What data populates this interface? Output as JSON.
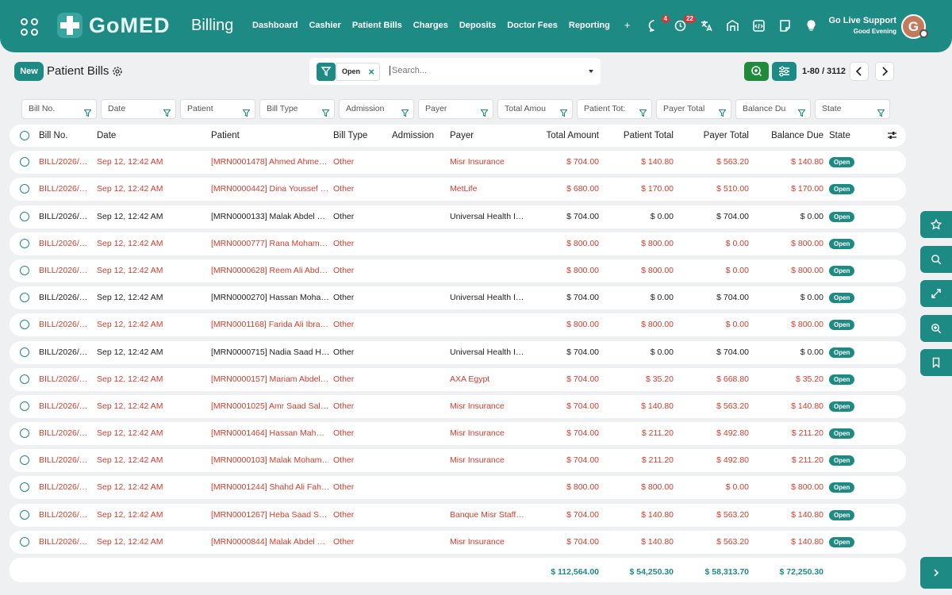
{
  "header": {
    "brand": "GoMED",
    "app_title": "Billing",
    "nav": [
      "Dashboard",
      "Cashier",
      "Patient Bills",
      "Charges",
      "Deposits",
      "Doctor Fees",
      "Reporting"
    ],
    "nav_plus": "+",
    "messages_count": "4",
    "activity_count": "22",
    "support_title": "Go Live Support",
    "support_greeting": "Good Evening",
    "avatar_initial": "G",
    "icons": [
      "apps-grid-icon",
      "chat-icon",
      "activity-icon",
      "translate-icon",
      "building-icon",
      "code-icon",
      "note-icon",
      "lightbulb-icon"
    ],
    "accent": "#1d8a84"
  },
  "toolbar": {
    "new_label": "New",
    "page_title": "Patient Bills",
    "facet_label": "Open",
    "facet_remove": "×",
    "search_placeholder": "Search...",
    "pager": "1-80 / 3112"
  },
  "filters": [
    "Bill No.",
    "Date",
    "Patient",
    "Bill Type",
    "Admission",
    "Payer",
    "Total Amou",
    "Patient Tot:",
    "Payer Total",
    "Balance Du",
    "State"
  ],
  "columns": [
    "Bill No.",
    "Date",
    "Patient",
    "Bill Type",
    "Admission",
    "Payer",
    "Total Amount",
    "Patient Total",
    "Payer Total",
    "Balance Due",
    "State"
  ],
  "rows": [
    {
      "bill": "BILL/2026/…",
      "date": "Sep 12, 12:42 AM",
      "patient": "[MRN0001478] Ahmed Ahme…",
      "type": "Other",
      "admission": "",
      "payer": "Misr Insurance",
      "total": "$ 704.00",
      "ptotal": "$ 140.80",
      "paytotal": "$ 563.20",
      "balance": "$ 140.80",
      "state": "Open",
      "style": "red"
    },
    {
      "bill": "BILL/2026/…",
      "date": "Sep 12, 12:42 AM",
      "patient": "[MRN0000442] Dina Youssef …",
      "type": "Other",
      "admission": "",
      "payer": "MetLife",
      "total": "$ 680.00",
      "ptotal": "$ 170.00",
      "paytotal": "$ 510.00",
      "balance": "$ 170.00",
      "state": "Open",
      "style": "red"
    },
    {
      "bill": "BILL/2026/…",
      "date": "Sep 12, 12:42 AM",
      "patient": "[MRN0000133] Malak Abdel …",
      "type": "Other",
      "admission": "",
      "payer": "Universal Health I…",
      "total": "$ 704.00",
      "ptotal": "$ 0.00",
      "paytotal": "$ 704.00",
      "balance": "$ 0.00",
      "state": "Open",
      "style": "dark"
    },
    {
      "bill": "BILL/2026/…",
      "date": "Sep 12, 12:42 AM",
      "patient": "[MRN0000777] Rana Moham…",
      "type": "Other",
      "admission": "",
      "payer": "",
      "total": "$ 800.00",
      "ptotal": "$ 800.00",
      "paytotal": "$ 0.00",
      "balance": "$ 800.00",
      "state": "Open",
      "style": "red"
    },
    {
      "bill": "BILL/2026/…",
      "date": "Sep 12, 12:42 AM",
      "patient": "[MRN0000628] Reem Ali Abd…",
      "type": "Other",
      "admission": "",
      "payer": "",
      "total": "$ 800.00",
      "ptotal": "$ 800.00",
      "paytotal": "$ 0.00",
      "balance": "$ 800.00",
      "state": "Open",
      "style": "red"
    },
    {
      "bill": "BILL/2026/…",
      "date": "Sep 12, 12:42 AM",
      "patient": "[MRN0000270] Hassan Moha…",
      "type": "Other",
      "admission": "",
      "payer": "Universal Health I…",
      "total": "$ 704.00",
      "ptotal": "$ 0.00",
      "paytotal": "$ 704.00",
      "balance": "$ 0.00",
      "state": "Open",
      "style": "dark"
    },
    {
      "bill": "BILL/2026/…",
      "date": "Sep 12, 12:42 AM",
      "patient": "[MRN0001168] Farida Ali Ibra…",
      "type": "Other",
      "admission": "",
      "payer": "",
      "total": "$ 800.00",
      "ptotal": "$ 800.00",
      "paytotal": "$ 0.00",
      "balance": "$ 800.00",
      "state": "Open",
      "style": "red"
    },
    {
      "bill": "BILL/2026/…",
      "date": "Sep 12, 12:42 AM",
      "patient": "[MRN0000715] Nadia Saad H…",
      "type": "Other",
      "admission": "",
      "payer": "Universal Health I…",
      "total": "$ 704.00",
      "ptotal": "$ 0.00",
      "paytotal": "$ 704.00",
      "balance": "$ 0.00",
      "state": "Open",
      "style": "dark"
    },
    {
      "bill": "BILL/2026/…",
      "date": "Sep 12, 12:42 AM",
      "patient": "[MRN0000157] Mariam Abdel…",
      "type": "Other",
      "admission": "",
      "payer": "AXA Egypt",
      "total": "$ 704.00",
      "ptotal": "$ 35.20",
      "paytotal": "$ 668.80",
      "balance": "$ 35.20",
      "state": "Open",
      "style": "red"
    },
    {
      "bill": "BILL/2026/…",
      "date": "Sep 12, 12:42 AM",
      "patient": "[MRN0001025] Amr Saad Sal…",
      "type": "Other",
      "admission": "",
      "payer": "Misr Insurance",
      "total": "$ 704.00",
      "ptotal": "$ 140.80",
      "paytotal": "$ 563.20",
      "balance": "$ 140.80",
      "state": "Open",
      "style": "red"
    },
    {
      "bill": "BILL/2026/…",
      "date": "Sep 12, 12:42 AM",
      "patient": "[MRN0001464] Hassan Mah…",
      "type": "Other",
      "admission": "",
      "payer": "Misr Insurance",
      "total": "$ 704.00",
      "ptotal": "$ 211.20",
      "paytotal": "$ 492.80",
      "balance": "$ 211.20",
      "state": "Open",
      "style": "red"
    },
    {
      "bill": "BILL/2026/…",
      "date": "Sep 12, 12:42 AM",
      "patient": "[MRN0000103] Malak Moham…",
      "type": "Other",
      "admission": "",
      "payer": "Misr Insurance",
      "total": "$ 704.00",
      "ptotal": "$ 211.20",
      "paytotal": "$ 492.80",
      "balance": "$ 211.20",
      "state": "Open",
      "style": "red"
    },
    {
      "bill": "BILL/2026/…",
      "date": "Sep 12, 12:42 AM",
      "patient": "[MRN0001244] Shahd Ali Fah…",
      "type": "Other",
      "admission": "",
      "payer": "",
      "total": "$ 800.00",
      "ptotal": "$ 800.00",
      "paytotal": "$ 0.00",
      "balance": "$ 800.00",
      "state": "Open",
      "style": "red"
    },
    {
      "bill": "BILL/2026/…",
      "date": "Sep 12, 12:42 AM",
      "patient": "[MRN0001267] Heba Saad S…",
      "type": "Other",
      "admission": "",
      "payer": "Banque Misr Staff…",
      "total": "$ 704.00",
      "ptotal": "$ 140.80",
      "paytotal": "$ 563.20",
      "balance": "$ 140.80",
      "state": "Open",
      "style": "red"
    },
    {
      "bill": "BILL/2026/…",
      "date": "Sep 12, 12:42 AM",
      "patient": "[MRN0000844] Malak Abdel …",
      "type": "Other",
      "admission": "",
      "payer": "Misr Insurance",
      "total": "$ 704.00",
      "ptotal": "$ 140.80",
      "paytotal": "$ 563.20",
      "balance": "$ 140.80",
      "state": "Open",
      "style": "red"
    }
  ],
  "totals": {
    "total": "$ 112,564.00",
    "ptotal": "$ 54,250.30",
    "paytotal": "$ 58,313.70",
    "balance": "$ 72,250.30"
  },
  "side_panel": [
    "star-icon",
    "search-icon",
    "expand-icon",
    "zoom-in-icon",
    "bookmark-icon",
    "chevron-right-icon"
  ]
}
